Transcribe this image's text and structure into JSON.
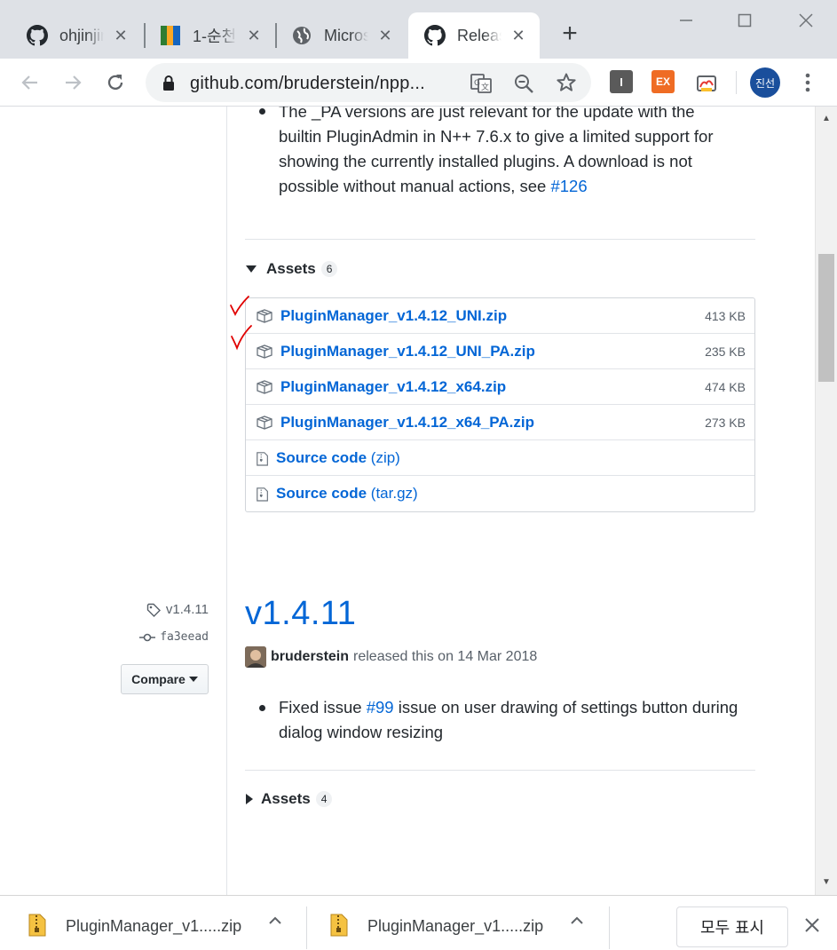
{
  "browser": {
    "tabs": [
      {
        "title": "ohjinjin",
        "icon": "github-icon"
      },
      {
        "title": "1-순천",
        "icon": "green-book-icon"
      },
      {
        "title": "Microsoft",
        "icon": "globe-icon"
      },
      {
        "title": "Releases",
        "icon": "github-icon",
        "active": true
      }
    ],
    "url": "github.com/bruderstein/npp...",
    "extensions": [
      "I",
      "EX"
    ],
    "profile_label": "진선"
  },
  "release_top": {
    "note_lines": [
      "The _PA versions are just relevant for the update with the",
      "builtin PluginAdmin in N++ 7.6.x to give a limited support for",
      "showing the currently installed plugins. A download is not"
    ],
    "note_last_prefix": "possible without manual actions, see ",
    "note_link": "#126",
    "assets_label": "Assets",
    "assets_count": "6",
    "assets": [
      {
        "name": "PluginManager_v1.4.12_UNI.zip",
        "size": "413 KB"
      },
      {
        "name": "PluginManager_v1.4.12_UNI_PA.zip",
        "size": "235 KB"
      },
      {
        "name": "PluginManager_v1.4.12_x64.zip",
        "size": "474 KB"
      },
      {
        "name": "PluginManager_v1.4.12_x64_PA.zip",
        "size": "273 KB"
      }
    ],
    "source": [
      {
        "label": "Source code",
        "format": "(zip)"
      },
      {
        "label": "Source code",
        "format": "(tar.gz)"
      }
    ]
  },
  "release_next": {
    "tag": "v1.4.11",
    "commit": "fa3eead",
    "compare_label": "Compare",
    "title": "v1.4.11",
    "author": "bruderstein",
    "released_text": "released this on 14 Mar 2018",
    "note_prefix": "Fixed issue ",
    "note_link": "#99",
    "note_suffix": " issue on user drawing of settings button during",
    "note_line2": "dialog window resizing",
    "assets_label": "Assets",
    "assets_count": "4"
  },
  "downloads": {
    "items": [
      {
        "name": "PluginManager_v1.....zip"
      },
      {
        "name": "PluginManager_v1.....zip"
      }
    ],
    "show_all_label": "모두 표시"
  },
  "colors": {
    "link": "#0366d6",
    "annotation_red": "#e00000",
    "tabstrip": "#dee1e6"
  }
}
